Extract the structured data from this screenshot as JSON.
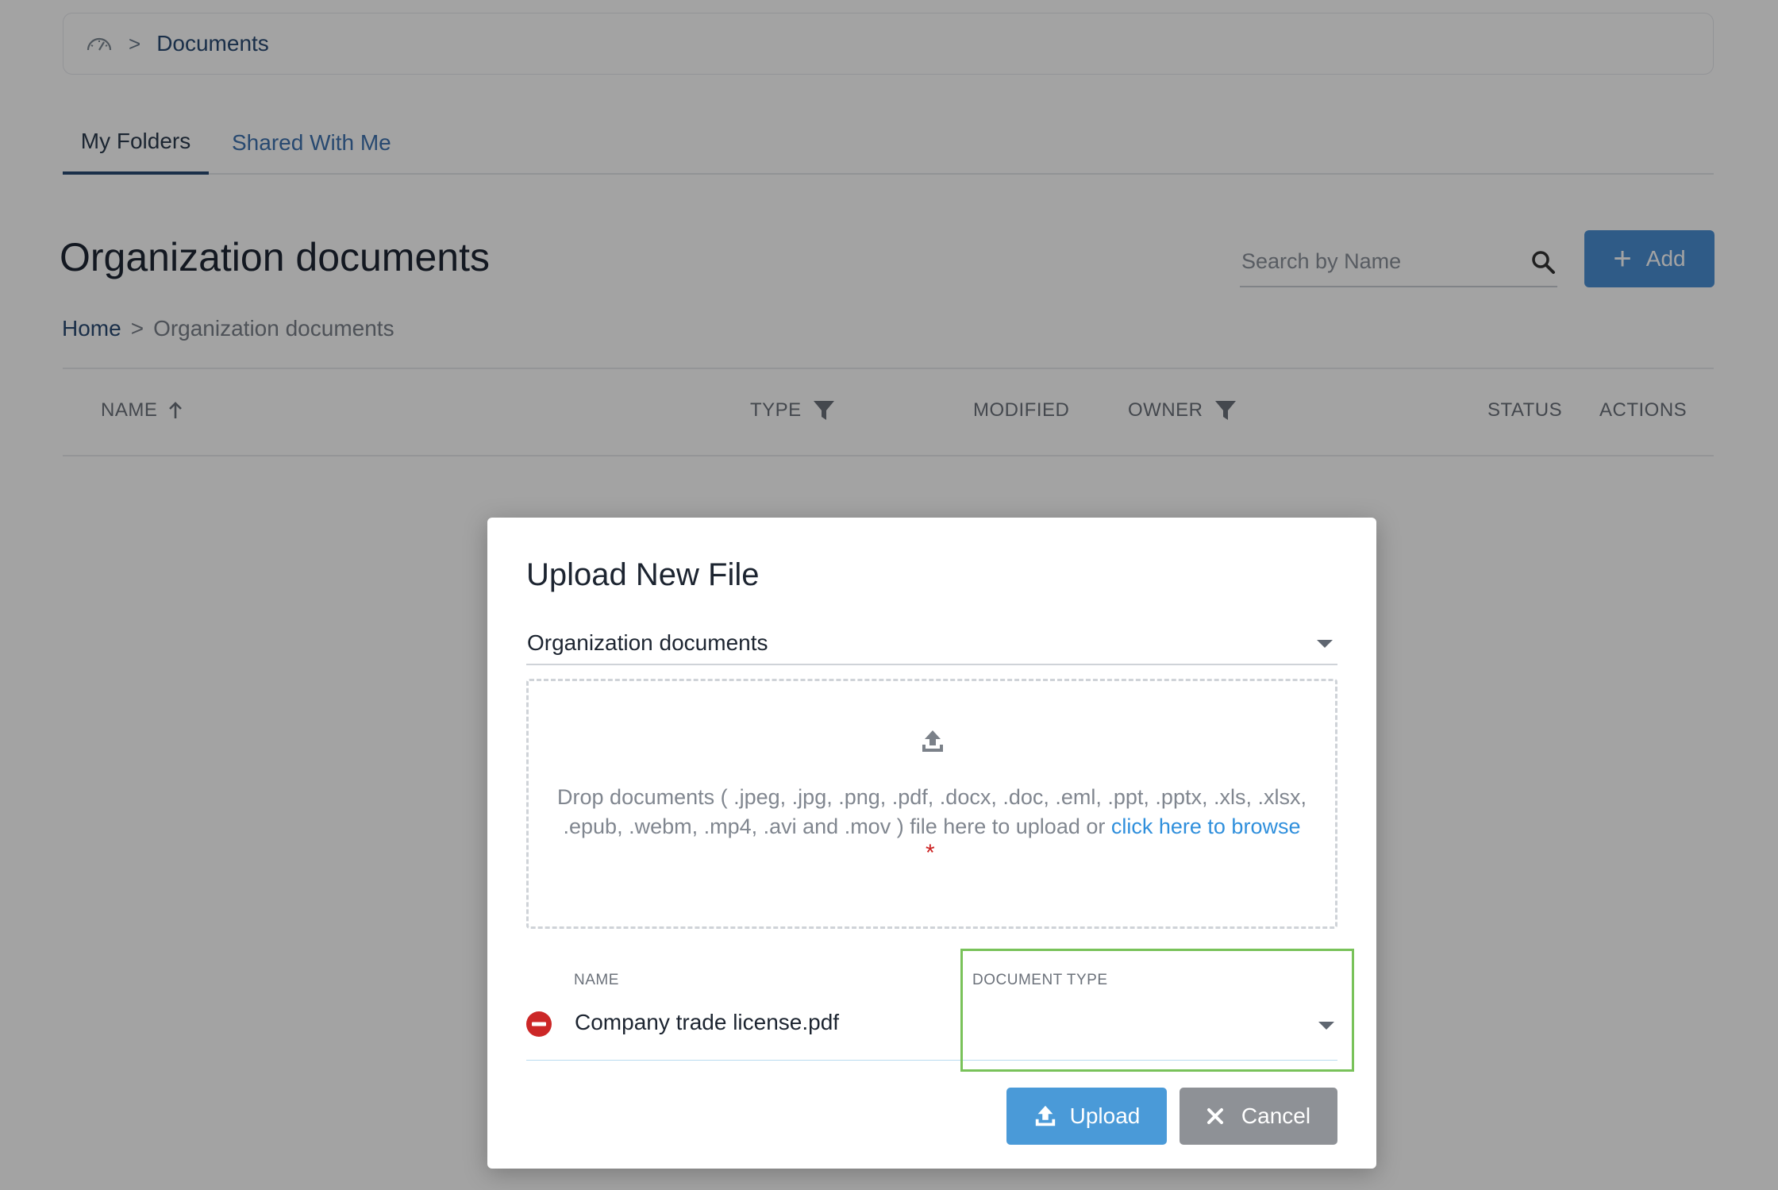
{
  "header": {
    "breadcrumb": {
      "current": "Documents",
      "separator": ">"
    }
  },
  "tabs": [
    {
      "label": "My Folders",
      "active": true
    },
    {
      "label": "Shared With Me",
      "active": false
    }
  ],
  "main": {
    "title": "Organization documents",
    "search": {
      "placeholder": "Search by Name",
      "value": ""
    },
    "add_label": "Add",
    "breadcrumb": {
      "home": "Home",
      "separator": ">",
      "current": "Organization documents"
    },
    "table": {
      "columns": [
        "NAME",
        "TYPE",
        "MODIFIED",
        "OWNER",
        "STATUS",
        "ACTIONS"
      ]
    }
  },
  "modal": {
    "title": "Upload New File",
    "folder_value": "Organization documents",
    "dropzone": {
      "text_line1": "Drop documents ( .jpeg, .jpg, .png, .pdf, .docx, .doc, .eml, .ppt, .pptx, .xls, .xlsx,",
      "text_line2": ".epub, .webm, .mp4, .avi and .mov ) file here to upload or",
      "browse_link": "click here to browse",
      "required_mark": "*"
    },
    "file_table": {
      "name_header": "NAME",
      "type_header": "DOCUMENT TYPE",
      "file_name": "Company trade license.pdf",
      "document_type_value": ""
    },
    "upload_label": "Upload",
    "cancel_label": "Cancel"
  },
  "colors": {
    "accent": "#4a9ad8",
    "navy": "#2a4a72",
    "highlight": "#79c25a",
    "remove": "#cc2727",
    "cancel_bg": "#8e9196"
  },
  "icons": [
    "dashboard-gauge-icon",
    "chevron-right-icon",
    "search-icon",
    "plus-icon",
    "arrow-up-icon",
    "filter-icon",
    "upload-icon",
    "remove-circle-icon",
    "caret-down-icon",
    "close-icon"
  ]
}
